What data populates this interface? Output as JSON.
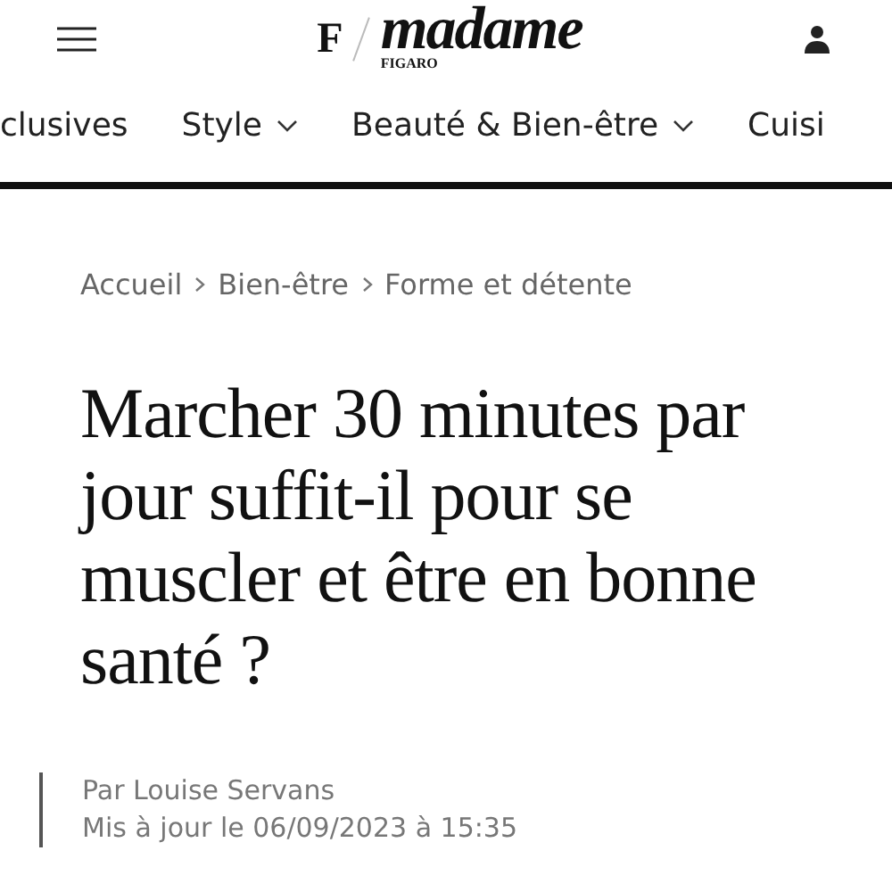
{
  "header": {
    "logo": {
      "mark": "F",
      "name": "madame",
      "sub": "FIGARO"
    }
  },
  "nav": [
    {
      "label": "clusives",
      "has_menu": false
    },
    {
      "label": "Style",
      "has_menu": true
    },
    {
      "label": "Beauté & Bien-être",
      "has_menu": true
    },
    {
      "label": "Cuisi",
      "has_menu": false
    }
  ],
  "breadcrumb": [
    "Accueil",
    "Bien-être",
    "Forme et détente"
  ],
  "article": {
    "title_lines": [
      "Marcher 30 minutes par",
      "jour suffit-il pour se",
      "muscler et être en bonne",
      "santé ?"
    ],
    "author": "Par Louise Servans",
    "updated": "Mis à jour le 06/09/2023 à 15:35"
  }
}
